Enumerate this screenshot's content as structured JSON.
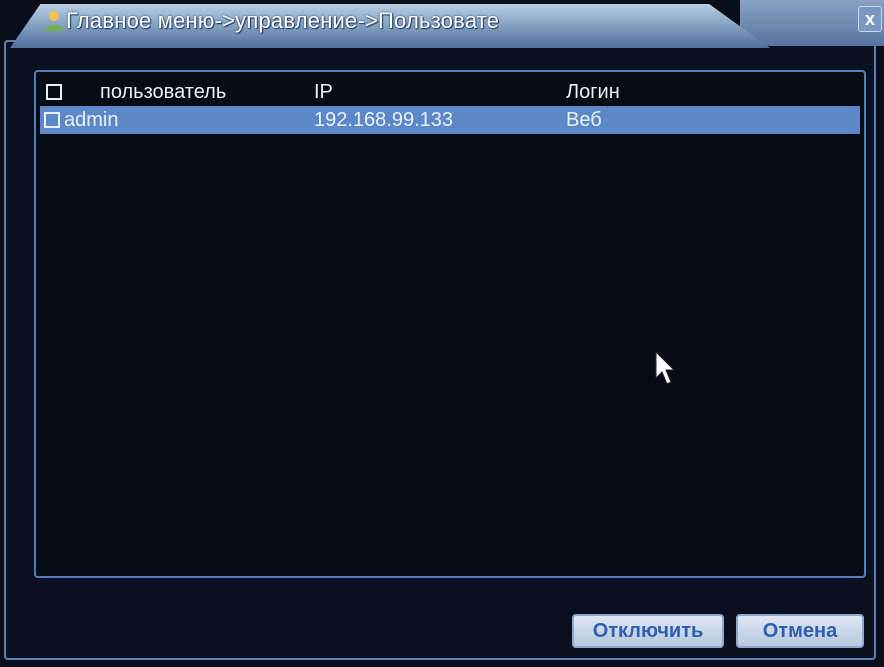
{
  "window": {
    "title": "Главное меню->управление->Пользовате",
    "close_label": "x"
  },
  "table": {
    "headers": {
      "user": "пользователь",
      "ip": "IP",
      "login": "Логин"
    },
    "rows": [
      {
        "user": "admin",
        "ip": "192.168.99.133",
        "login": "Веб",
        "selected": true
      }
    ]
  },
  "buttons": {
    "disconnect": "Отключить",
    "cancel": "Отмена"
  },
  "colors": {
    "accent": "#5d88c8",
    "frame": "#4f7fbf",
    "background": "#070b16"
  }
}
